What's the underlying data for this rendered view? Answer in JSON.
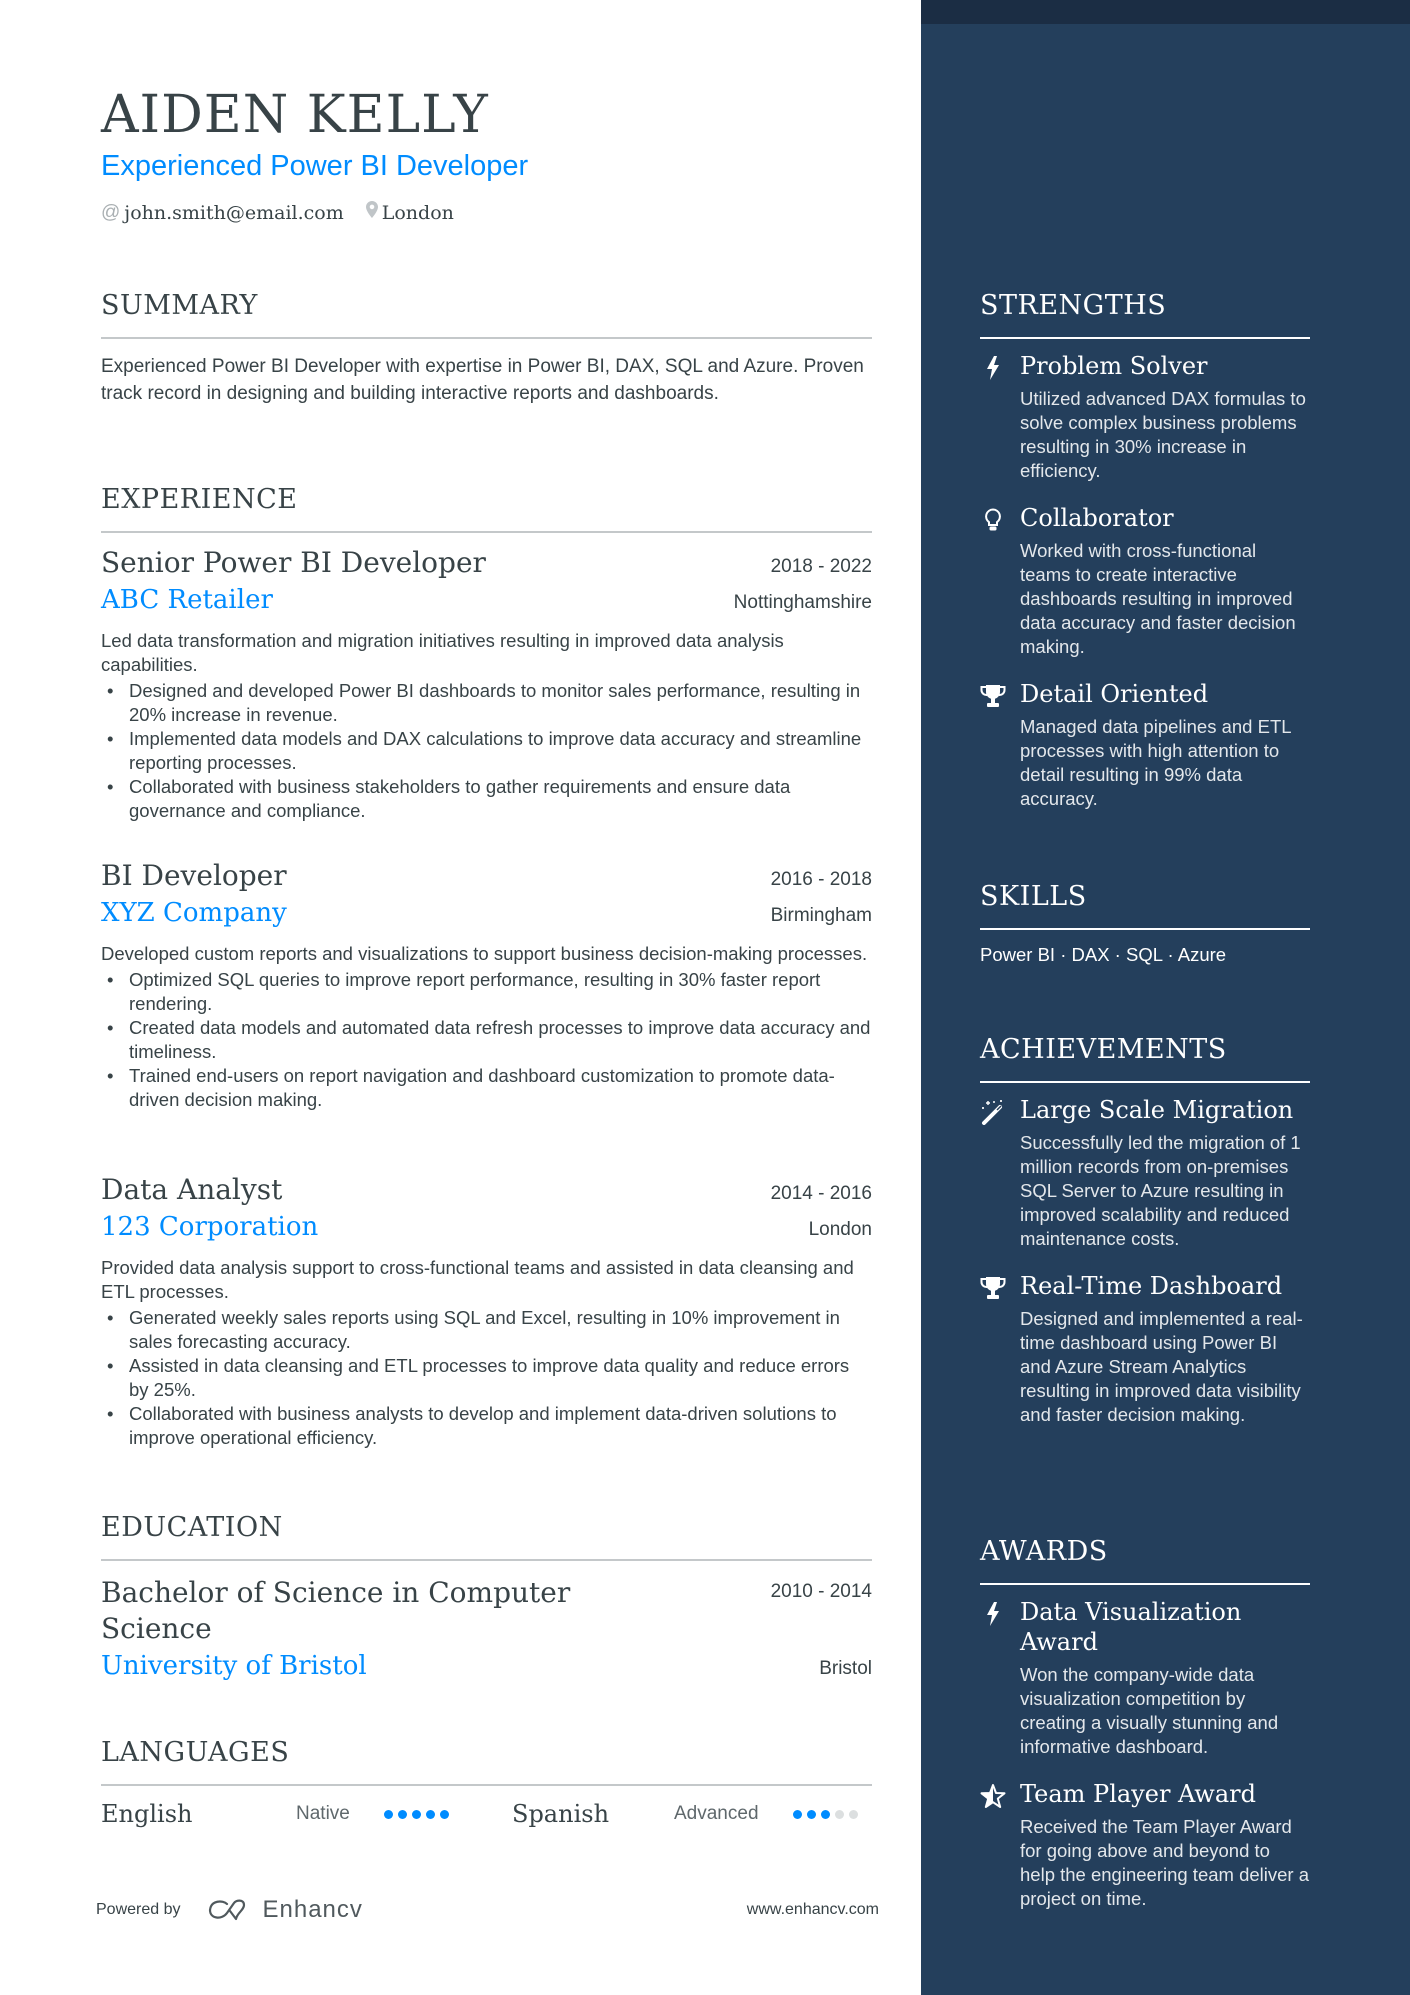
{
  "header": {
    "name": "AIDEN KELLY",
    "headline": "Experienced Power BI Developer",
    "contacts": [
      {
        "icon": "at-icon",
        "value": "john.smith@email.com"
      },
      {
        "icon": "location-pin-icon",
        "value": "London"
      }
    ]
  },
  "summary": {
    "title": "SUMMARY",
    "text": "Experienced Power BI Developer with expertise in Power BI, DAX, SQL and Azure. Proven track record in designing and building interactive reports and dashboards."
  },
  "experience": {
    "title": "EXPERIENCE",
    "jobs": [
      {
        "title": "Senior Power BI Developer",
        "dates": "2018 - 2022",
        "company": "ABC Retailer",
        "location": "Nottinghamshire",
        "description": "Led data transformation and migration initiatives resulting in improved data analysis capabilities.",
        "bullets": [
          "Designed and developed Power BI dashboards to monitor sales performance, resulting in 20% increase in revenue.",
          "Implemented data models and DAX calculations to improve data accuracy and streamline reporting processes.",
          "Collaborated with business stakeholders to gather requirements and ensure data governance and compliance."
        ]
      },
      {
        "title": "BI Developer",
        "dates": "2016 - 2018",
        "company": "XYZ Company",
        "location": "Birmingham",
        "description": "Developed custom reports and visualizations to support business decision-making processes.",
        "bullets": [
          "Optimized SQL queries to improve report performance, resulting in 30% faster report rendering.",
          "Created data models and automated data refresh processes to improve data accuracy and timeliness.",
          "Trained end-users on report navigation and dashboard customization to promote data-driven decision making."
        ]
      },
      {
        "title": "Data Analyst",
        "dates": "2014 - 2016",
        "company": "123 Corporation",
        "location": "London",
        "description": "Provided data analysis support to cross-functional teams and assisted in data cleansing and ETL processes.",
        "bullets": [
          "Generated weekly sales reports using SQL and Excel, resulting in 10% improvement in sales forecasting accuracy.",
          "Assisted in data cleansing and ETL processes to improve data quality and reduce errors by 25%.",
          "Collaborated with business analysts to develop and implement data-driven solutions to improve operational efficiency."
        ]
      }
    ]
  },
  "education": {
    "title": "EDUCATION",
    "entries": [
      {
        "degree": "Bachelor of Science in Computer Science",
        "dates": "2010 - 2014",
        "school": "University of Bristol",
        "location": "Bristol"
      }
    ]
  },
  "languages": {
    "title": "LANGUAGES",
    "items": [
      {
        "name": "English",
        "level": "Native",
        "rating": 5,
        "max": 5
      },
      {
        "name": "Spanish",
        "level": "Advanced",
        "rating": 3,
        "max": 5
      }
    ]
  },
  "strengths": {
    "title": "STRENGTHS",
    "items": [
      {
        "icon": "lightning-bolt-icon",
        "title": "Problem Solver",
        "description": "Utilized advanced DAX formulas to solve complex business problems resulting in 30% increase in efficiency."
      },
      {
        "icon": "lightbulb-icon",
        "title": "Collaborator",
        "description": "Worked with cross-functional teams to create interactive dashboards resulting in improved data accuracy and faster decision making."
      },
      {
        "icon": "trophy-icon",
        "title": "Detail Oriented",
        "description": "Managed data pipelines and ETL processes with high attention to detail resulting in 99% data accuracy."
      }
    ]
  },
  "skills": {
    "title": "SKILLS",
    "text": "Power BI · DAX · SQL · Azure"
  },
  "achievements": {
    "title": "ACHIEVEMENTS",
    "items": [
      {
        "icon": "magic-wand-icon",
        "title": "Large Scale Migration",
        "description": "Successfully led the migration of 1 million records from on-premises SQL Server to Azure resulting in improved scalability and reduced maintenance costs."
      },
      {
        "icon": "trophy-icon",
        "title": "Real-Time Dashboard",
        "description": "Designed and implemented a real-time dashboard using Power BI and Azure Stream Analytics resulting in improved data visibility and faster decision making."
      }
    ]
  },
  "awards": {
    "title": "AWARDS",
    "items": [
      {
        "icon": "lightning-bolt-icon",
        "title": "Data Visualization Award",
        "description": "Won the company-wide data visualization competition by creating a visually stunning and informative dashboard."
      },
      {
        "icon": "star-icon",
        "title": "Team Player Award",
        "description": "Received the Team Player Award for going above and beyond to help the engineering team deliver a project on time."
      }
    ]
  },
  "footer": {
    "powered_by": "Powered by",
    "brand": "Enhancv",
    "url": "www.enhancv.com"
  },
  "colors": {
    "accent": "#008cff",
    "sidebar": "#243f5c",
    "sidebar_top": "#1b2d44",
    "text": "#384347"
  }
}
